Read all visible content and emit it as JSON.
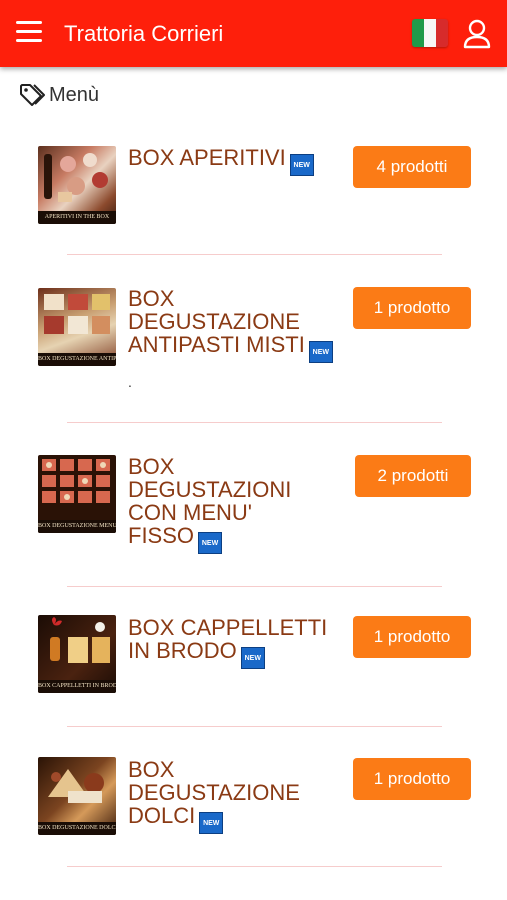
{
  "header": {
    "title": "Trattoria Corrieri",
    "language": "italian-flag-icon"
  },
  "breadcrumb": {
    "label": "Menù"
  },
  "colors": {
    "header": "#fe1f0b",
    "button": "#fb7b16",
    "title_text": "#8a3a14",
    "new_badge": "#1a69c9"
  },
  "new_badge_text": "NEW",
  "items": [
    {
      "name": "BOX APERITIVI",
      "count": "4 prodotti",
      "image_caption": "APERITIVI IN THE BOX",
      "note": ""
    },
    {
      "name": "BOX DEGUSTAZIONE ANTIPASTI MISTI",
      "count": "1 prodotto",
      "image_caption": "BOX DEGUSTAZIONE ANTIPASTI",
      "note": "."
    },
    {
      "name": "BOX DEGUSTAZIONI CON MENU' FISSO",
      "count": "2 prodotti",
      "image_caption": "BOX DEGUSTAZIONE MENU FISSO",
      "note": ""
    },
    {
      "name": "BOX CAPPELLETTI IN BRODO",
      "count": "1 prodotto",
      "image_caption": "BOX CAPPELLETTI IN BRODO",
      "note": ""
    },
    {
      "name": "BOX DEGUSTAZIONE DOLCI",
      "count": "1 prodotto",
      "image_caption": "BOX DEGUSTAZIONE DOLCI",
      "note": ""
    }
  ]
}
